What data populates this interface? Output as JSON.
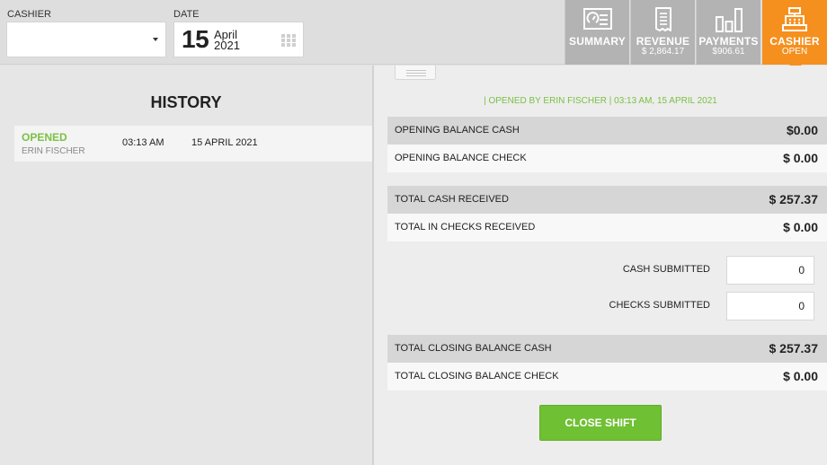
{
  "header": {
    "cashier_label": "CASHIER",
    "cashier_value": "",
    "date_label": "DATE",
    "date_day": "15",
    "date_month": "April",
    "date_year": "2021"
  },
  "nav": {
    "tabs": [
      {
        "label": "SUMMARY",
        "sub": "",
        "icon": "summary-icon"
      },
      {
        "label": "REVENUE",
        "sub": "$ 2,864.17",
        "icon": "receipt-icon"
      },
      {
        "label": "PAYMENTS",
        "sub": "$906.61",
        "icon": "bar-chart-icon"
      },
      {
        "label": "CASHIER",
        "sub": "OPEN",
        "icon": "cash-register-icon",
        "active": true
      }
    ],
    "active_color": "#f5901e"
  },
  "history": {
    "title": "HISTORY",
    "rows": [
      {
        "status": "OPENED",
        "name": "ERIN FISCHER",
        "time": "03:13 AM",
        "date": "15 APRIL 2021"
      }
    ],
    "status_color": "#7bc043"
  },
  "shift": {
    "opened_by": "| OPENED BY ERIN FISCHER | 03:13 AM, 15 APRIL 2021",
    "opening_cash_label": "OPENING BALANCE CASH",
    "opening_cash_value": "$0.00",
    "opening_check_label": "OPENING BALANCE CHECK",
    "opening_check_value": "$ 0.00",
    "total_cash_label": "TOTAL CASH RECEIVED",
    "total_cash_value": "$ 257.37",
    "total_checks_label": "TOTAL IN CHECKS RECEIVED",
    "total_checks_value": "$ 0.00",
    "cash_submitted_label": "CASH SUBMITTED",
    "cash_submitted_value": "0",
    "checks_submitted_label": "CHECKS SUBMITTED",
    "checks_submitted_value": "0",
    "closing_cash_label": "TOTAL CLOSING BALANCE CASH",
    "closing_cash_value": "$ 257.37",
    "closing_check_label": "TOTAL CLOSING BALANCE CHECK",
    "closing_check_value": "$ 0.00",
    "close_button": "CLOSE SHIFT",
    "close_button_color": "#6fc033"
  }
}
